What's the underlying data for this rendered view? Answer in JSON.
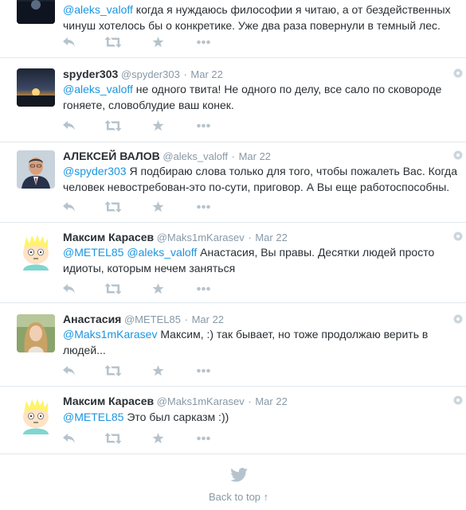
{
  "tweets": [
    {
      "partial": true,
      "text_parts": [
        {
          "mention": "@aleks_valoff"
        },
        {
          "plain": " когда я нуждаюсь философии я читаю, а от бездейственных чинуш хотелось бы о конкретике. Уже два раза повернули в темный лес."
        }
      ]
    },
    {
      "name": "spyder303",
      "handle": "@spyder303",
      "separator": "·",
      "time": "Mar 22",
      "avatar": "sunset-avatar",
      "text_parts": [
        {
          "mention": "@aleks_valoff"
        },
        {
          "plain": " не одного твита! Не одного по делу, все сало по сковороде гоняете, словоблудие ваш конек."
        }
      ]
    },
    {
      "name": "АЛЕКСЕЙ ВАЛОВ",
      "handle": "@aleks_valoff",
      "separator": "·",
      "time": "Mar 22",
      "avatar": "man-portrait-avatar",
      "text_parts": [
        {
          "mention": "@spyder303"
        },
        {
          "plain": " Я подбираю слова только для того, чтобы пожалеть Вас. Когда человек невостребован-это по-сути, приговор. А Вы еще работоспособны."
        }
      ]
    },
    {
      "name": "Максим Карасев",
      "handle": "@Maks1mKarasev",
      "separator": "·",
      "time": "Mar 22",
      "avatar": "cartoon-avatar",
      "text_parts": [
        {
          "mention": "@METEL85"
        },
        {
          "plain": " "
        },
        {
          "mention": "@aleks_valoff"
        },
        {
          "plain": " Анастасия, Вы правы. Десятки людей просто идиоты, которым нечем заняться"
        }
      ]
    },
    {
      "name": "Анастасия",
      "handle": "@METEL85",
      "separator": "·",
      "time": "Mar 22",
      "avatar": "woman-portrait-avatar",
      "text_parts": [
        {
          "mention": "@Maks1mKarasev"
        },
        {
          "plain": " Максим, :) так бывает, но тоже продолжаю верить в людей..."
        }
      ]
    },
    {
      "name": "Максим Карасев",
      "handle": "@Maks1mKarasev",
      "separator": "·",
      "time": "Mar 22",
      "avatar": "cartoon-avatar",
      "text_parts": [
        {
          "mention": "@METEL85"
        },
        {
          "plain": " Это был сарказм :))"
        }
      ]
    }
  ],
  "action_icons": [
    "reply-icon",
    "retweet-icon",
    "favorite-icon",
    "more-icon"
  ],
  "footer": {
    "back_to_top": "Back to top ↑",
    "icon": "twitter-bird-icon"
  },
  "colors": {
    "mention": "#1b95e0",
    "meta": "#8899a6",
    "text": "#292f33",
    "divider": "#e1e8ed",
    "icon": "#b6c3cc"
  }
}
